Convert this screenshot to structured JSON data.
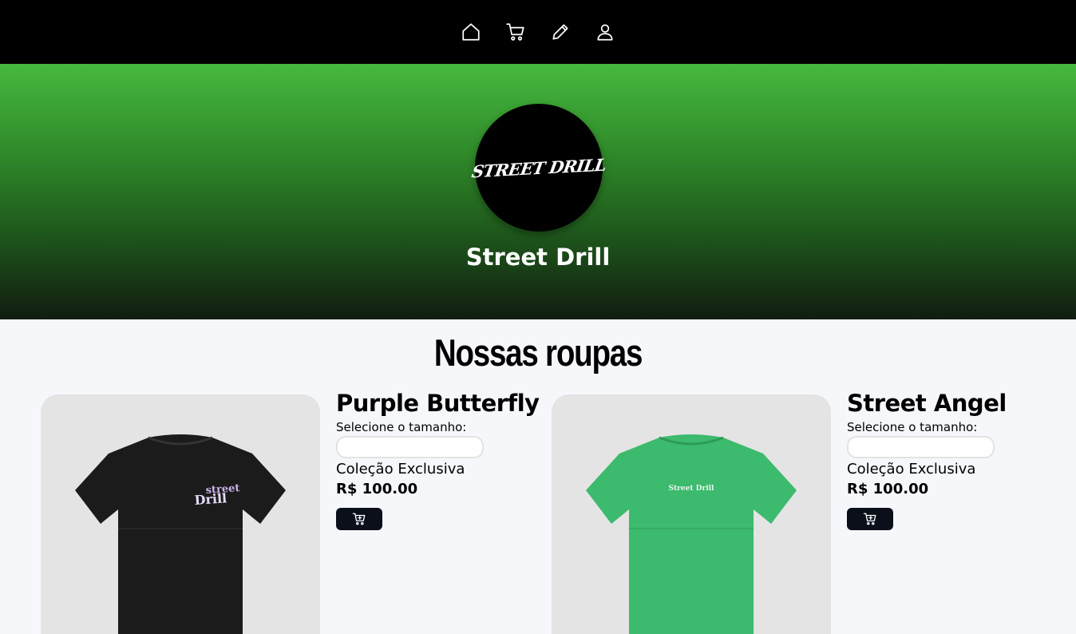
{
  "nav": {
    "items": [
      {
        "icon": "home-icon"
      },
      {
        "icon": "cart-icon"
      },
      {
        "icon": "pencil-icon"
      },
      {
        "icon": "user-icon"
      }
    ]
  },
  "hero": {
    "logo_text": "STREET DRILL",
    "brand_name": "Street Drill",
    "gradient_top": "#46b93e",
    "gradient_bottom": "#111c10"
  },
  "section": {
    "title": "Nossas roupas"
  },
  "products": [
    {
      "name": "Purple Butterfly",
      "size_label": "Selecione o tamanho:",
      "size_value": "",
      "collection": "Coleção Exclusiva",
      "price": "R$ 100.00",
      "shirt_color": "#1b1b1b",
      "print_text": "Street Drill"
    },
    {
      "name": "Street Angel",
      "size_label": "Selecione o tamanho:",
      "size_value": "",
      "collection": "Coleção Exclusiva",
      "price": "R$ 100.00",
      "shirt_color": "#3cba6d",
      "print_text": "Street Drill"
    }
  ],
  "colors": {
    "navbar": "#000000",
    "page_bg": "#f5f7fb",
    "button_bg": "#0b0f1a"
  }
}
